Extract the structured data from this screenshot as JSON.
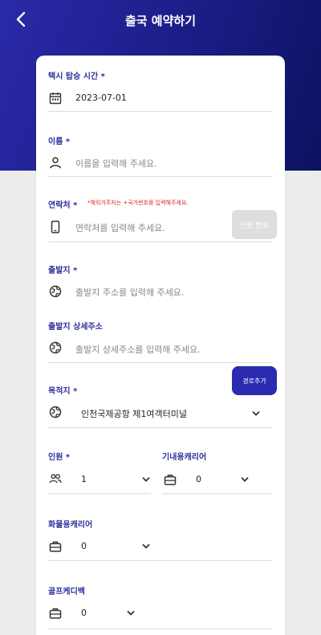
{
  "header": {
    "title": "출국 예약하기"
  },
  "form": {
    "pickup_time": {
      "label": "택시 탑승 시간 *",
      "value": "2023-07-01"
    },
    "name": {
      "label": "이름 *",
      "placeholder": "이름을 입력해 주세요."
    },
    "contact": {
      "label": "연락처 *",
      "note": "*해외거주자는 +국가번호를 입력해주세요.",
      "placeholder": "연락처를 입력해 주세요.",
      "verify_button": "인증 번호"
    },
    "departure": {
      "label": "출발지 *",
      "placeholder": "출발지 주소를 입력해 주세요."
    },
    "departure_detail": {
      "label": "출발지 상세주소",
      "placeholder": "출발지 상세주소를 입력해 주세요."
    },
    "destination": {
      "label": "목적지 *",
      "value": "인천국제공항 제1여객터미널",
      "add_waypoint_button": "경로추가"
    },
    "passengers": {
      "label": "인원 *",
      "value": "1"
    },
    "carry_on": {
      "label": "기내용캐리어",
      "value": "0"
    },
    "checked_luggage": {
      "label": "화물용캐리어",
      "value": "0"
    },
    "golf_bag": {
      "label": "골프케디백",
      "value": "0"
    }
  },
  "icons": {
    "back": "chevron-left-icon",
    "calendar": "calendar-icon",
    "person": "person-icon",
    "phone": "smartphone-icon",
    "location": "globe-icon",
    "group": "group-icon",
    "luggage": "suitcase-icon",
    "dropdown": "chevron-down-icon"
  },
  "colors": {
    "header_start": "#2a2aa8",
    "header_end": "#0d1260",
    "accent": "#2e2e9c",
    "note_red": "#d42c2c",
    "button_disabled": "#dedede"
  }
}
